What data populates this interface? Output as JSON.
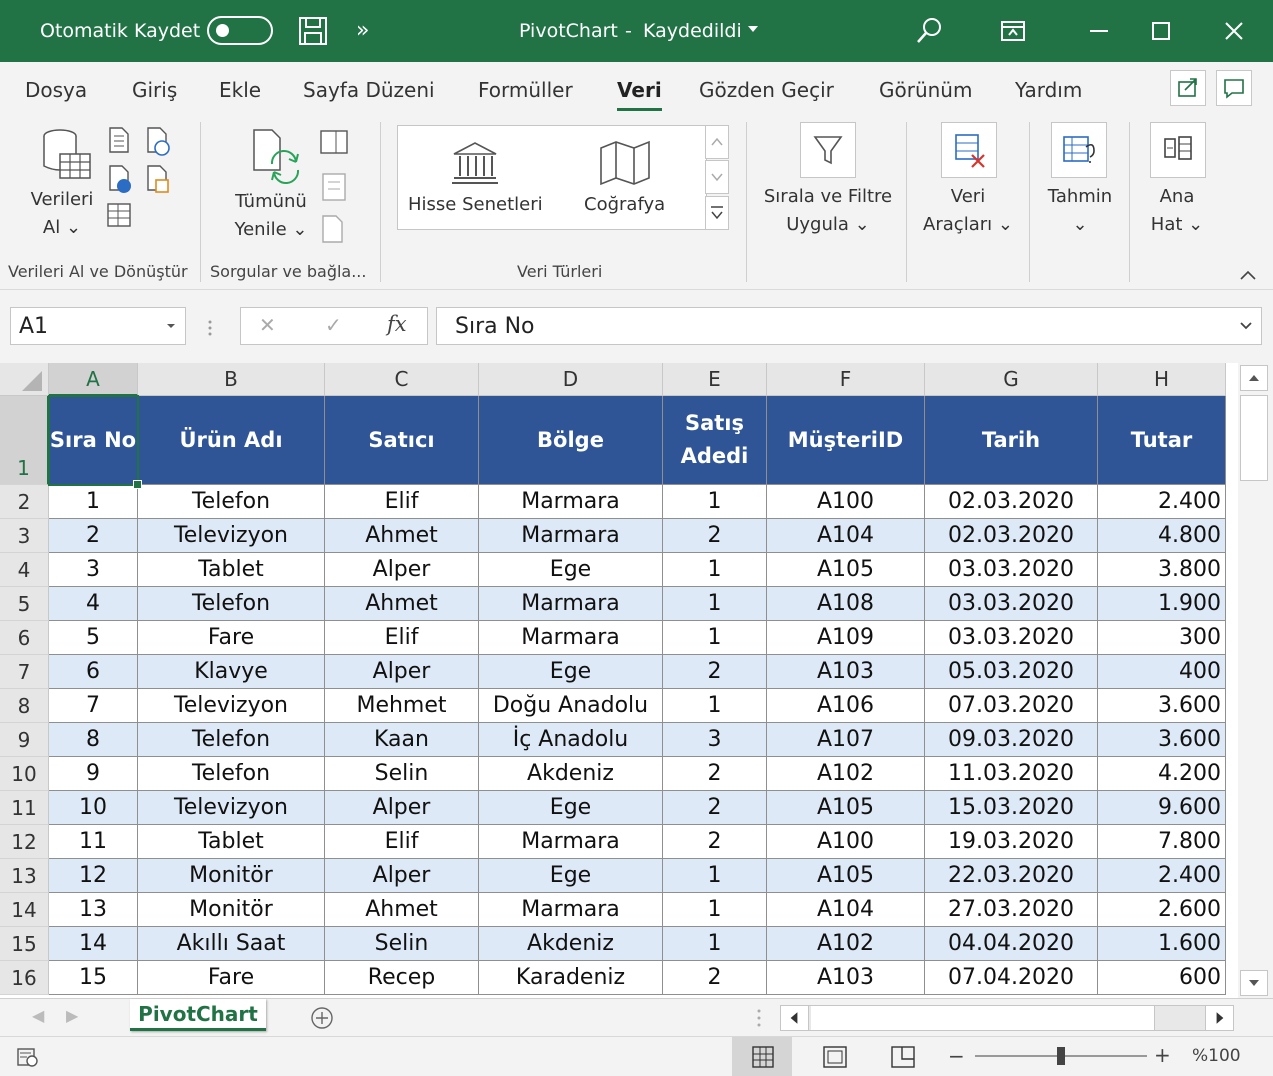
{
  "titlebar": {
    "autosave_label": "Otomatik Kaydet",
    "autosave_state": "off",
    "more_label": "»",
    "file_name": "PivotChart",
    "separator": "-",
    "save_status": "Kaydedildi",
    "accent_color": "#217346"
  },
  "tabs": [
    "Dosya",
    "Giriş",
    "Ekle",
    "Sayfa Düzeni",
    "Formüller",
    "Veri",
    "Gözden Geçir",
    "Görünüm",
    "Yardım"
  ],
  "active_tab": "Veri",
  "ribbon": {
    "get_data_line1": "Verileri",
    "get_data_line2": "Al",
    "refresh_line1": "Tümünü",
    "refresh_line2": "Yenile",
    "stocks_label": "Hisse Senetleri",
    "geography_label": "Coğrafya",
    "sort_filter_line1": "Sırala ve Filtre",
    "sort_filter_line2": "Uygula",
    "data_tools_line1": "Veri",
    "data_tools_line2": "Araçları",
    "forecast_label": "Tahmin",
    "outline_line1": "Ana",
    "outline_line2": "Hat",
    "group_get_transform": "Verileri Al ve Dönüştür",
    "group_queries": "Sorgular ve bağla...",
    "group_data_types": "Veri Türleri"
  },
  "formula_bar": {
    "name_box": "A1",
    "fx_label": "fx",
    "cancel": "✕",
    "enter": "✓",
    "content": "Sıra No"
  },
  "grid": {
    "columns": [
      "A",
      "B",
      "C",
      "D",
      "E",
      "F",
      "G",
      "H"
    ],
    "header_row_number": "1",
    "headers": [
      [
        "Sıra No"
      ],
      [
        "Ürün Adı"
      ],
      [
        "Satıcı"
      ],
      [
        "Bölge"
      ],
      [
        "Satış",
        "Adedi"
      ],
      [
        "MüşteriID"
      ],
      [
        "Tarih"
      ],
      [
        "Tutar"
      ]
    ],
    "header_fill": "#2f5597",
    "band_fill": "#dde9f6",
    "rows": [
      [
        "2",
        "1",
        "Telefon",
        "Elif",
        "Marmara",
        "1",
        "A100",
        "02.03.2020",
        "2.400"
      ],
      [
        "3",
        "2",
        "Televizyon",
        "Ahmet",
        "Marmara",
        "2",
        "A104",
        "02.03.2020",
        "4.800"
      ],
      [
        "4",
        "3",
        "Tablet",
        "Alper",
        "Ege",
        "1",
        "A105",
        "03.03.2020",
        "3.800"
      ],
      [
        "5",
        "4",
        "Telefon",
        "Ahmet",
        "Marmara",
        "1",
        "A108",
        "03.03.2020",
        "1.900"
      ],
      [
        "6",
        "5",
        "Fare",
        "Elif",
        "Marmara",
        "1",
        "A109",
        "03.03.2020",
        "300"
      ],
      [
        "7",
        "6",
        "Klavye",
        "Alper",
        "Ege",
        "2",
        "A103",
        "05.03.2020",
        "400"
      ],
      [
        "8",
        "7",
        "Televizyon",
        "Mehmet",
        "Doğu Anadolu",
        "1",
        "A106",
        "07.03.2020",
        "3.600"
      ],
      [
        "9",
        "8",
        "Telefon",
        "Kaan",
        "İç Anadolu",
        "3",
        "A107",
        "09.03.2020",
        "3.600"
      ],
      [
        "10",
        "9",
        "Telefon",
        "Selin",
        "Akdeniz",
        "2",
        "A102",
        "11.03.2020",
        "4.200"
      ],
      [
        "11",
        "10",
        "Televizyon",
        "Alper",
        "Ege",
        "2",
        "A105",
        "15.03.2020",
        "9.600"
      ],
      [
        "12",
        "11",
        "Tablet",
        "Elif",
        "Marmara",
        "2",
        "A100",
        "19.03.2020",
        "7.800"
      ],
      [
        "13",
        "12",
        "Monitör",
        "Alper",
        "Ege",
        "1",
        "A105",
        "22.03.2020",
        "2.400"
      ],
      [
        "14",
        "13",
        "Monitör",
        "Ahmet",
        "Marmara",
        "1",
        "A104",
        "27.03.2020",
        "2.600"
      ],
      [
        "15",
        "14",
        "Akıllı Saat",
        "Selin",
        "Akdeniz",
        "1",
        "A102",
        "04.04.2020",
        "1.600"
      ],
      [
        "16",
        "15",
        "Fare",
        "Recep",
        "Karadeniz",
        "2",
        "A103",
        "07.04.2020",
        "600"
      ]
    ]
  },
  "sheets": {
    "active": "PivotChart",
    "add_label": "+"
  },
  "status": {
    "zoom": "%100",
    "zoom_fraction": 0.5
  }
}
